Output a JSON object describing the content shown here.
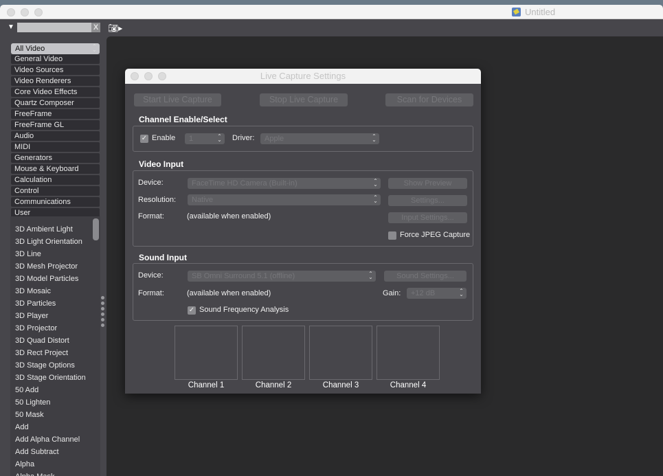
{
  "window": {
    "title": "Untitled"
  },
  "toolbar": {
    "clear_label": "X",
    "search_value": ""
  },
  "categories": [
    "All Video",
    "General Video",
    "Video Sources",
    "Video Renderers",
    "Core Video Effects",
    "Quartz Composer",
    "FreeFrame",
    "FreeFrame GL",
    "Audio",
    "MIDI",
    "Generators",
    "Mouse & Keyboard",
    "Calculation",
    "Control",
    "Communications",
    "User"
  ],
  "library": [
    "3D Ambient Light",
    "3D Light Orientation",
    "3D Line",
    "3D Mesh Projector",
    "3D Model Particles",
    "3D Mosaic",
    "3D Particles",
    "3D Player",
    "3D Projector",
    "3D Quad Distort",
    "3D Rect Project",
    "3D Stage Options",
    "3D Stage Orientation",
    "50 Add",
    "50 Lighten",
    "50 Mask",
    "Add",
    "Add Alpha Channel",
    "Add Subtract",
    "Alpha",
    "Alpha Mask"
  ],
  "dialog": {
    "title": "Live Capture Settings",
    "start": "Start Live Capture",
    "stop": "Stop Live Capture",
    "scan": "Scan for Devices",
    "channel": {
      "heading": "Channel Enable/Select",
      "enable": "Enable",
      "enabled": true,
      "channel_value": "1",
      "driver_label": "Driver:",
      "driver_value": "Apple"
    },
    "video": {
      "heading": "Video Input",
      "device_label": "Device:",
      "device_value": "FaceTime HD Camera (Built-in)",
      "resolution_label": "Resolution:",
      "resolution_value": "Native",
      "format_label": "Format:",
      "format_value": "(available when enabled)",
      "show_preview": "Show Preview",
      "settings": "Settings...",
      "input_settings": "Input Settings...",
      "force_jpeg": "Force JPEG Capture",
      "force_jpeg_checked": false
    },
    "sound": {
      "heading": "Sound Input",
      "device_label": "Device:",
      "device_value": "SB Omni Surround 5.1 (offline)",
      "sound_settings": "Sound Settings...",
      "format_label": "Format:",
      "format_value": "(available when enabled)",
      "gain_label": "Gain:",
      "gain_value": "+12 dB",
      "analysis": "Sound Frequency Analysis",
      "analysis_checked": true
    },
    "channels": [
      "Channel 1",
      "Channel 2",
      "Channel 3",
      "Channel 4"
    ]
  }
}
